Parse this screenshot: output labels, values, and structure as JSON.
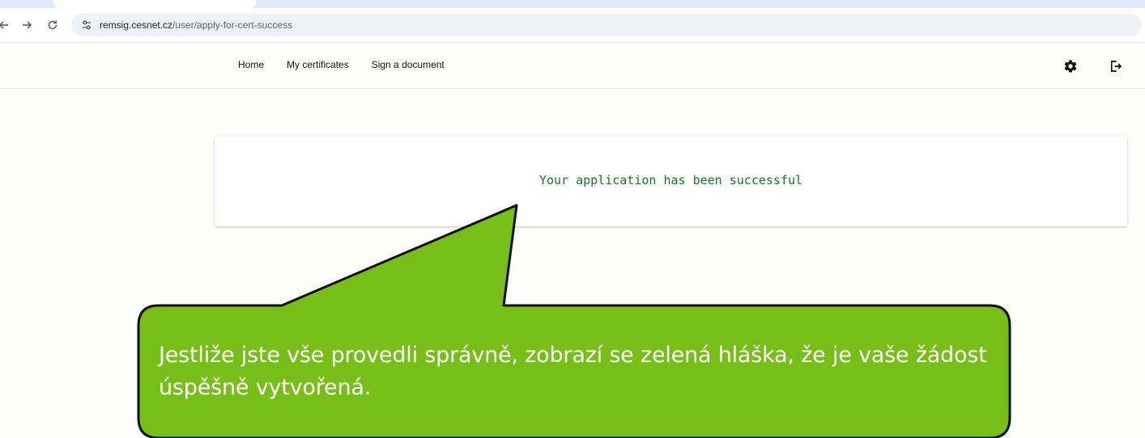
{
  "browser": {
    "url_host": "remsig.cesnet.cz",
    "url_path": "/user/apply-for-cert-success",
    "icons": [
      "back-icon",
      "forward-icon",
      "reload-icon",
      "site-info-icon"
    ]
  },
  "header": {
    "nav": [
      "Home",
      "My certificates",
      "Sign a document"
    ],
    "icons": [
      "gear-icon",
      "logout-icon"
    ]
  },
  "card": {
    "message": "Your application has been successful",
    "message_color": "#157a1e"
  },
  "callout": {
    "text": "Jestliže jste vše provedli správně, zobrazí se zelená hláška, že je vaše žádost úspěšně vytvořená.",
    "fill_color": "#78be19",
    "border_color": "#111111"
  }
}
